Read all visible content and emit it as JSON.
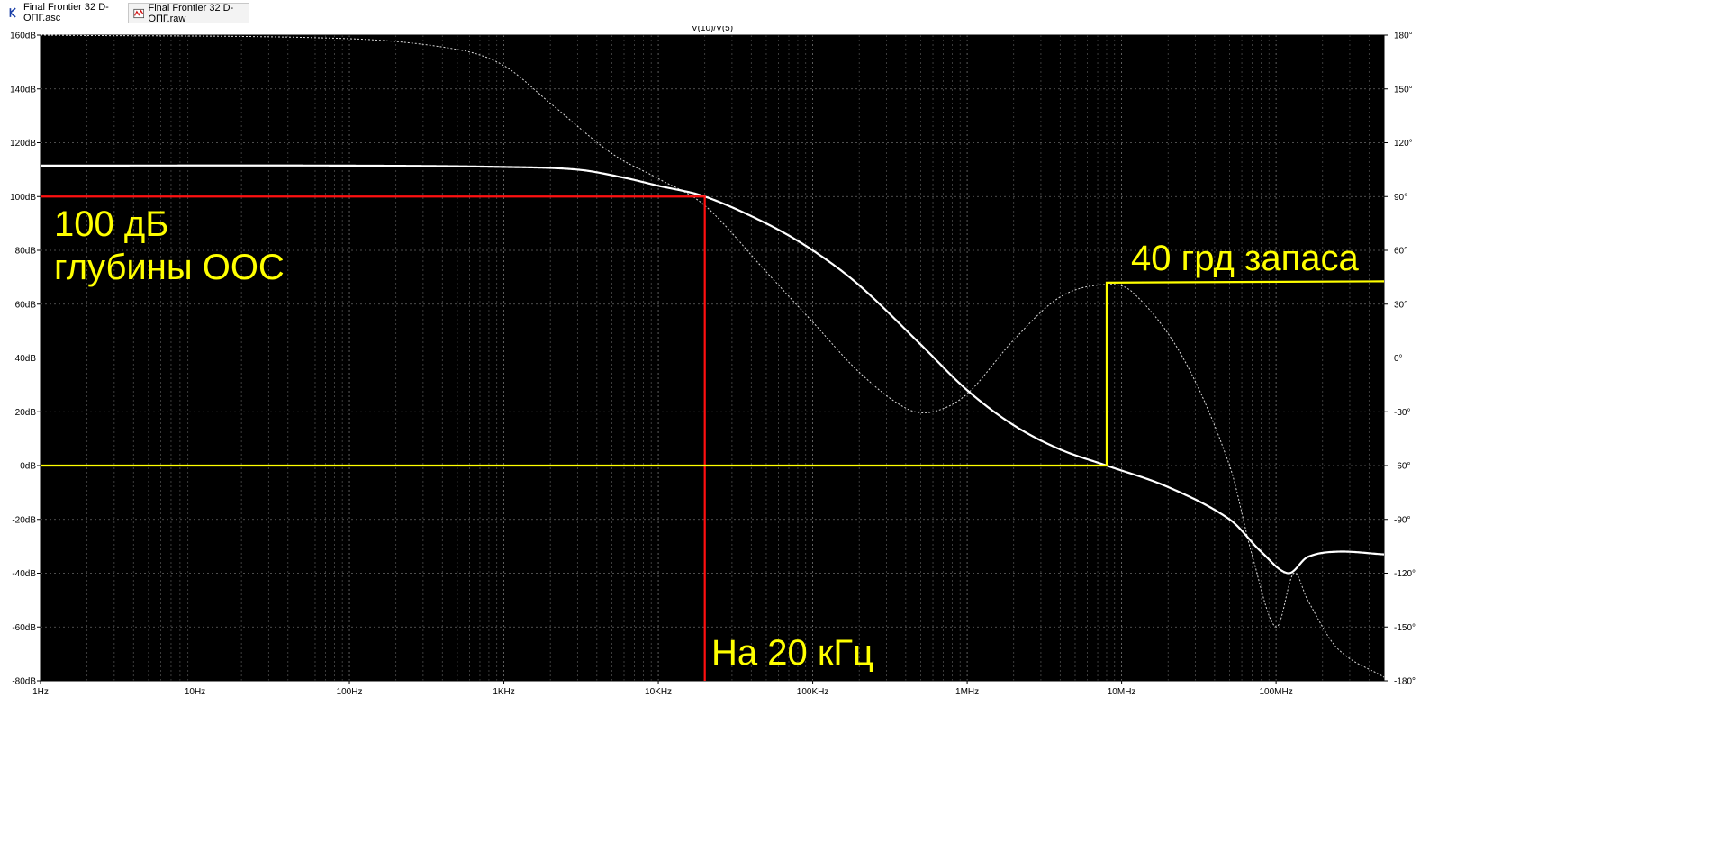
{
  "tabs": [
    {
      "label": "Final Frontier 32 D-ОПГ.asc",
      "icon": "schematic-icon",
      "active": false
    },
    {
      "label": "Final Frontier 32 D-ОПГ.raw",
      "icon": "waveform-icon",
      "active": true
    }
  ],
  "colors": {
    "background": "#000000",
    "grid": "#8a8a8a",
    "gain_trace": "#ffffff",
    "phase_trace": "#ffffff",
    "axis_text": "#ffffff",
    "marker_red": "#ff1010",
    "marker_yellow": "#ffff00"
  },
  "chart_data": {
    "type": "line",
    "title": "V(10)/V(5)",
    "x_scale": "log",
    "xlim": [
      1,
      500000000
    ],
    "x_ticks": [
      {
        "value": 1,
        "label": "1Hz"
      },
      {
        "value": 10,
        "label": "10Hz"
      },
      {
        "value": 100,
        "label": "100Hz"
      },
      {
        "value": 1000,
        "label": "1KHz"
      },
      {
        "value": 10000,
        "label": "10KHz"
      },
      {
        "value": 100000,
        "label": "100KHz"
      },
      {
        "value": 1000000,
        "label": "1MHz"
      },
      {
        "value": 10000000,
        "label": "10MHz"
      },
      {
        "value": 100000000,
        "label": "100MHz"
      }
    ],
    "y_left": {
      "lim": [
        -80,
        160
      ],
      "ticks": [
        {
          "value": 160,
          "label": "160dB"
        },
        {
          "value": 140,
          "label": "140dB"
        },
        {
          "value": 120,
          "label": "120dB"
        },
        {
          "value": 100,
          "label": "100dB"
        },
        {
          "value": 80,
          "label": "80dB"
        },
        {
          "value": 60,
          "label": "60dB"
        },
        {
          "value": 40,
          "label": "40dB"
        },
        {
          "value": 20,
          "label": "20dB"
        },
        {
          "value": 0,
          "label": "0dB"
        },
        {
          "value": -20,
          "label": "-20dB"
        },
        {
          "value": -40,
          "label": "-40dB"
        },
        {
          "value": -60,
          "label": "-60dB"
        },
        {
          "value": -80,
          "label": "-80dB"
        }
      ]
    },
    "y_right": {
      "lim": [
        -180,
        180
      ],
      "ticks": [
        {
          "value": 180,
          "label": "180°"
        },
        {
          "value": 150,
          "label": "150°"
        },
        {
          "value": 120,
          "label": "120°"
        },
        {
          "value": 90,
          "label": "90°"
        },
        {
          "value": 60,
          "label": "60°"
        },
        {
          "value": 30,
          "label": "30°"
        },
        {
          "value": 0,
          "label": "0°"
        },
        {
          "value": -30,
          "label": "-30°"
        },
        {
          "value": -60,
          "label": "-60°"
        },
        {
          "value": -90,
          "label": "-90°"
        },
        {
          "value": -120,
          "label": "-120°"
        },
        {
          "value": -150,
          "label": "-150°"
        },
        {
          "value": -180,
          "label": "-180°"
        }
      ]
    },
    "grid": true,
    "series": [
      {
        "axis": "left",
        "style": "solid",
        "points": [
          [
            1,
            111.5
          ],
          [
            100,
            111.5
          ],
          [
            1000,
            111
          ],
          [
            3000,
            110
          ],
          [
            6000,
            107
          ],
          [
            10000,
            104
          ],
          [
            20000,
            100
          ],
          [
            50000,
            90
          ],
          [
            100000,
            80
          ],
          [
            200000,
            67
          ],
          [
            500000,
            45
          ],
          [
            1000000,
            28
          ],
          [
            2000000,
            15
          ],
          [
            4000000,
            6
          ],
          [
            8000000,
            0
          ],
          [
            20000000,
            -8
          ],
          [
            50000000,
            -20
          ],
          [
            80000000,
            -32
          ],
          [
            120000000,
            -40
          ],
          [
            160000000,
            -34
          ],
          [
            250000000,
            -32
          ],
          [
            500000000,
            -33
          ]
        ]
      },
      {
        "axis": "right",
        "style": "dashed",
        "points": [
          [
            1,
            180
          ],
          [
            100,
            178
          ],
          [
            500,
            172
          ],
          [
            1000,
            163
          ],
          [
            2000,
            142
          ],
          [
            5000,
            114
          ],
          [
            10000,
            100
          ],
          [
            20000,
            85
          ],
          [
            50000,
            48
          ],
          [
            100000,
            20
          ],
          [
            200000,
            -8
          ],
          [
            400000,
            -28
          ],
          [
            600000,
            -30
          ],
          [
            1000000,
            -20
          ],
          [
            2000000,
            10
          ],
          [
            4000000,
            34
          ],
          [
            8000000,
            41
          ],
          [
            12000000,
            36
          ],
          [
            25000000,
            0
          ],
          [
            50000000,
            -60
          ],
          [
            70000000,
            -110
          ],
          [
            100000000,
            -150
          ],
          [
            130000000,
            -120
          ],
          [
            160000000,
            -135
          ],
          [
            250000000,
            -162
          ],
          [
            500000000,
            -178
          ]
        ]
      }
    ],
    "markers": [
      {
        "color": "red",
        "points": [
          [
            1,
            100
          ],
          [
            20000,
            100
          ],
          [
            20000,
            -80
          ]
        ]
      },
      {
        "color": "yellow",
        "points": [
          [
            1,
            0
          ],
          [
            8000000,
            0
          ],
          [
            8000000,
            68
          ],
          [
            500000000,
            68.5
          ]
        ]
      }
    ],
    "annotations": [
      {
        "id": "depth",
        "lines": [
          "100 дБ",
          "глубины ООС"
        ],
        "color": "yellow"
      },
      {
        "id": "freq",
        "lines": [
          "На 20 кГц"
        ],
        "color": "yellow"
      },
      {
        "id": "margin",
        "lines": [
          "40 грд запаса"
        ],
        "color": "yellow"
      }
    ]
  }
}
